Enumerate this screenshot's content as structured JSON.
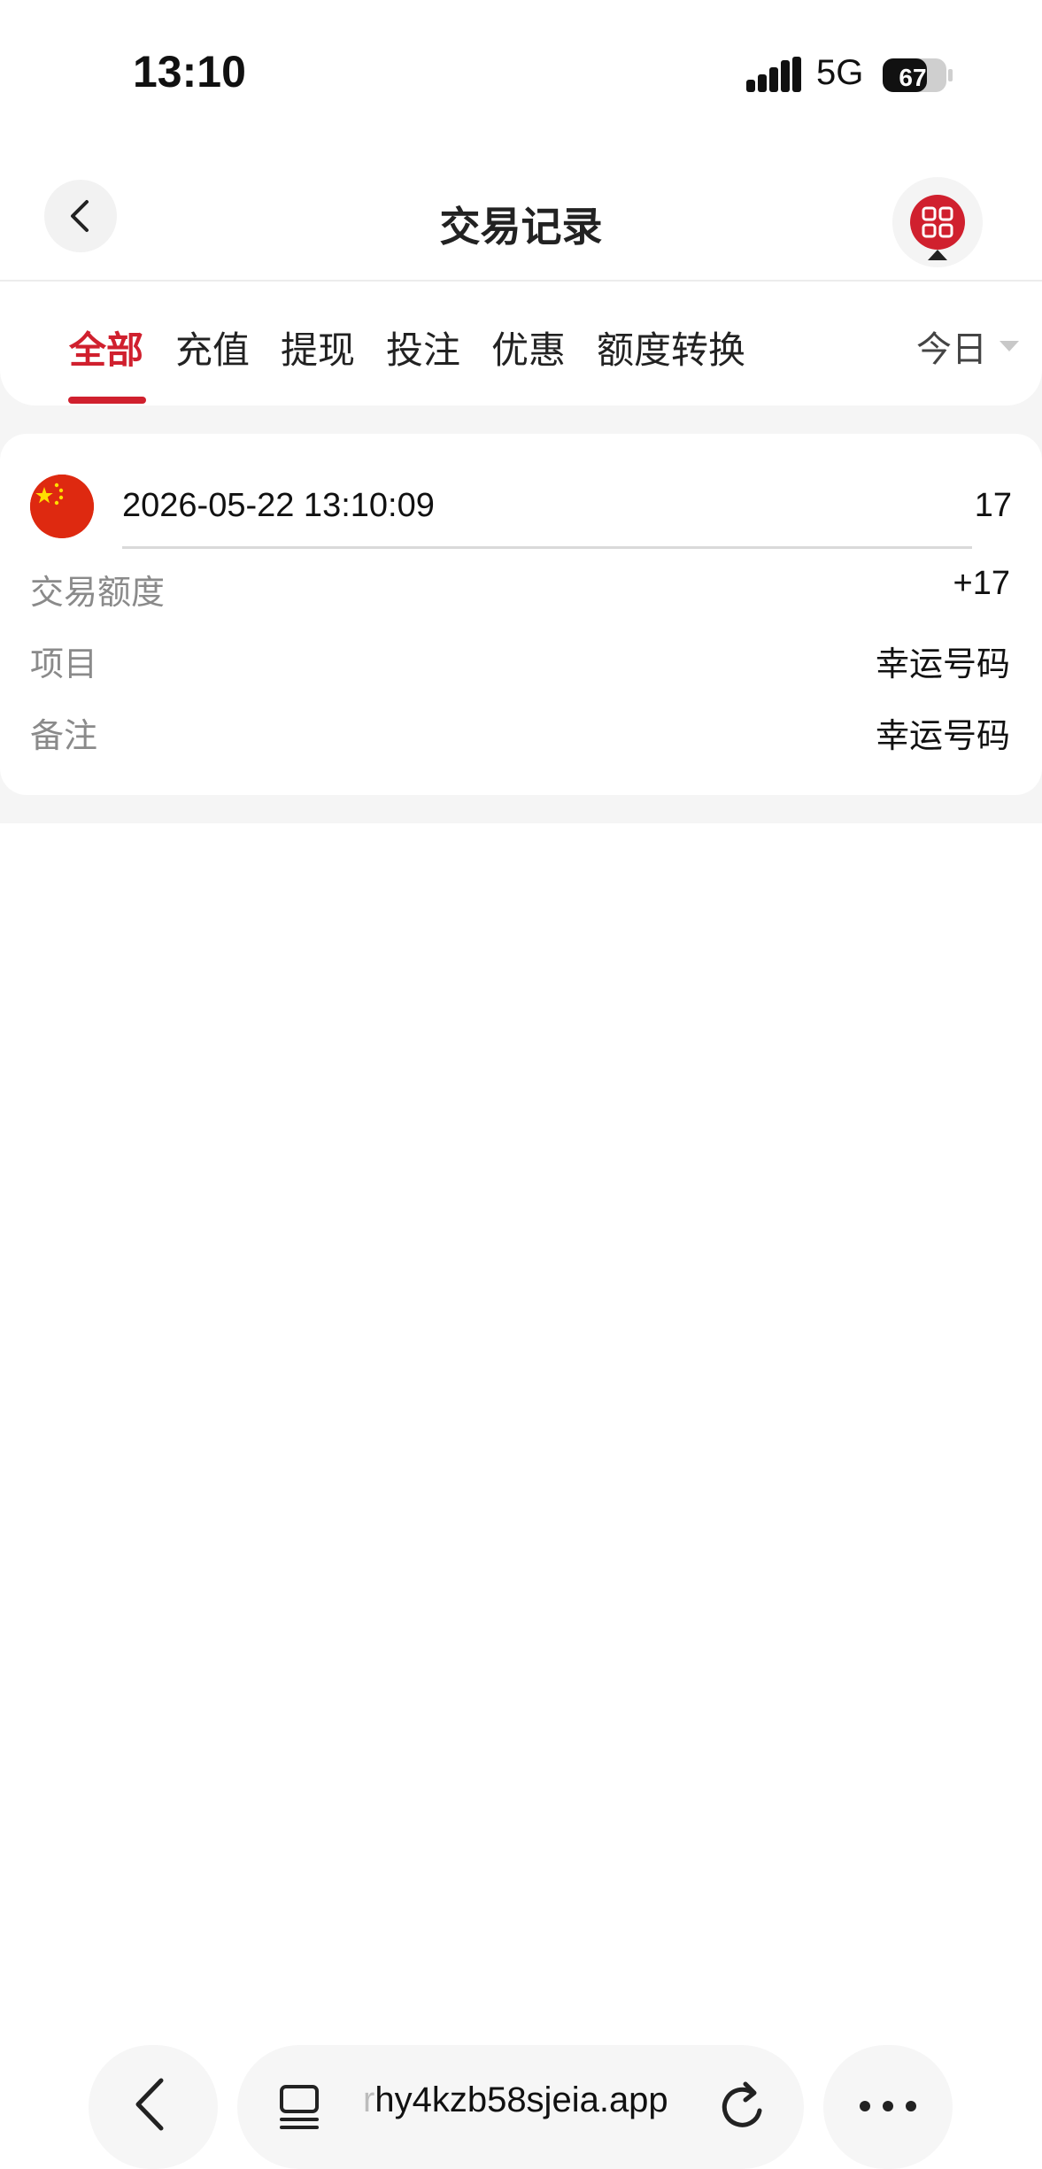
{
  "status_bar": {
    "time": "13:10",
    "network": "5G",
    "battery": "67"
  },
  "header": {
    "title": "交易记录",
    "back_icon": "chevron-left-icon",
    "menu_icon": "grid-icon"
  },
  "tabs": {
    "items": [
      {
        "label": "全部",
        "active": true
      },
      {
        "label": "充值",
        "active": false
      },
      {
        "label": "提现",
        "active": false
      },
      {
        "label": "投注",
        "active": false
      },
      {
        "label": "优惠",
        "active": false
      },
      {
        "label": "额度转换",
        "active": false
      }
    ],
    "date_filter": "今日"
  },
  "records": [
    {
      "flag_icon": "china-flag-icon",
      "datetime": "2026-05-22 13:10:09",
      "amount": "17",
      "rows": [
        {
          "label": "交易额度",
          "value": "+17"
        },
        {
          "label": "项目",
          "value": "幸运号码"
        },
        {
          "label": "备注",
          "value": "幸运号码"
        }
      ]
    }
  ],
  "browser": {
    "url_prefix": "r",
    "url": "hy4kzb58sjeia.app"
  },
  "colors": {
    "accent": "#d0202e",
    "background": "#f5f5f5"
  }
}
